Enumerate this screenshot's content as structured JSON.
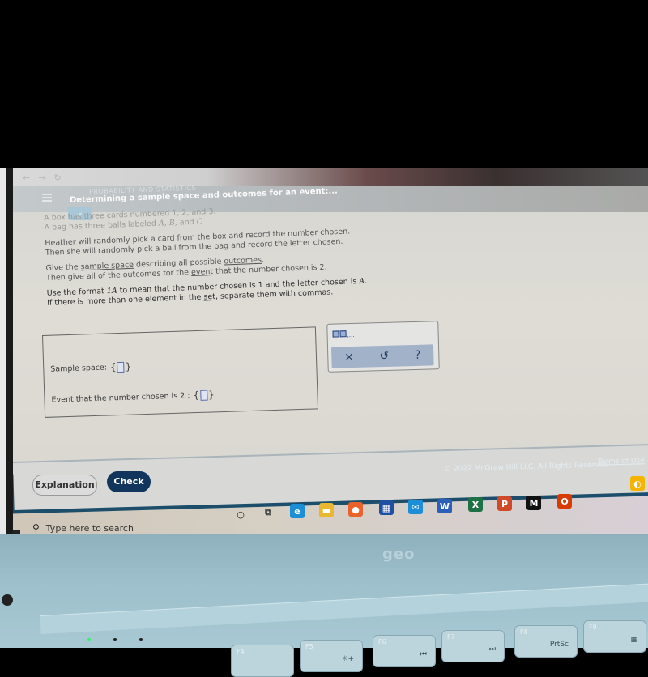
{
  "browser": {
    "back_icon": "←",
    "forward_icon": "→",
    "reload_icon": "↻"
  },
  "header": {
    "section": "PROBABILITY AND STATISTICS",
    "title": "Determining a sample space and outcomes for an event:...",
    "collapse_icon": "⌄"
  },
  "problem": {
    "line1": "A box has three cards numbered 1, 2, and 3.",
    "line2_pre": "A bag has three balls labeled ",
    "line2_math": "A, B,",
    "line2_post": " and ",
    "line2_math2": "C",
    "line3": "Heather will randomly pick a card from the box and record the number chosen.",
    "line4": "Then she will randomly pick a ball from the bag and record the letter chosen.",
    "line5_pre": "Give the ",
    "line5_link1": "sample space",
    "line5_mid": " describing all possible ",
    "line5_link2": "outcomes",
    "line5_post": ".",
    "line6_pre": "Then give all of the outcomes for the ",
    "line6_link": "event",
    "line6_post": " that the number chosen is 2.",
    "line7_pre": "Use the format ",
    "line7_math": "1A",
    "line7_mid": " to mean that the number chosen is 1 and the letter chosen is ",
    "line7_math2": "A",
    "line7_post": ".",
    "line8_pre": "If there is more than one element in the ",
    "line8_link": "set",
    "line8_post": ", separate them with commas."
  },
  "answers": {
    "sample_space_label": "Sample space:",
    "sample_space_value": "",
    "event_label": "Event that the number chosen is 2 :",
    "event_value": "",
    "brace_open": "{",
    "brace_close": "}"
  },
  "keypad": {
    "template_label": "□,□,...",
    "clear_icon": "×",
    "undo_icon": "↺",
    "help_icon": "?"
  },
  "footer": {
    "explanation_label": "Explanation",
    "check_label": "Check",
    "copyright": "© 2022 McGraw Hill LLC. All Rights Reserved.",
    "terms": "Terms of Use"
  },
  "taskbar": {
    "search_placeholder": "Type here to search",
    "apps": [
      {
        "name": "cortana",
        "glyph": "○",
        "color": "#222222"
      },
      {
        "name": "task-view",
        "glyph": "⧉",
        "color": "#333333"
      },
      {
        "name": "edge",
        "glyph": "e",
        "color": "#1a8fd6"
      },
      {
        "name": "file-explorer",
        "glyph": "▬",
        "color": "#e8b830"
      },
      {
        "name": "firefox",
        "glyph": "●",
        "color": "#e8622a"
      },
      {
        "name": "store",
        "glyph": "▦",
        "color": "#1e4fa0"
      },
      {
        "name": "mail",
        "glyph": "✉",
        "color": "#1d8ed8"
      },
      {
        "name": "word",
        "glyph": "W",
        "color": "#2b5fb8"
      },
      {
        "name": "excel",
        "glyph": "X",
        "color": "#1e7145"
      },
      {
        "name": "powerpoint",
        "glyph": "P",
        "color": "#d04a2a"
      },
      {
        "name": "mcgraw",
        "glyph": "M",
        "color": "#111111"
      },
      {
        "name": "office",
        "glyph": "O",
        "color": "#d83b01"
      },
      {
        "name": "chrome",
        "glyph": "◐",
        "color": "#f4b400"
      }
    ]
  },
  "laptop": {
    "brand": "geo",
    "keys": [
      {
        "fn": "F4",
        "label": ""
      },
      {
        "fn": "F5",
        "label": "☼+"
      },
      {
        "fn": "F6",
        "label": "⏮"
      },
      {
        "fn": "F7",
        "label": "⏭"
      },
      {
        "fn": "F8",
        "label": "PrtSc"
      },
      {
        "fn": "F9",
        "label": "▦"
      }
    ]
  }
}
